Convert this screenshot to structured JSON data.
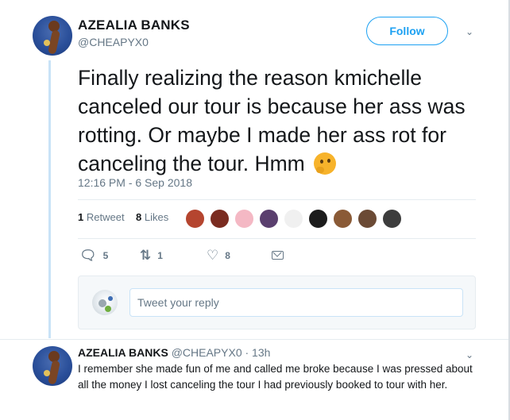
{
  "tweet": {
    "author": {
      "name": "AZEALIA BANKS",
      "handle": "@CHEAPYX0"
    },
    "follow_label": "Follow",
    "text": "Finally realizing the reason kmichelle canceled our tour is because her ass was rotting. Or maybe I made her ass rot for canceling the tour. Hmm",
    "timestamp": "12:16 PM - 6 Sep 2018",
    "stats": {
      "retweets_count": "1",
      "retweets_label": "Retweet",
      "likes_count": "8",
      "likes_label": "Likes"
    },
    "liker_colors": [
      "#b5452f",
      "#7a2b20",
      "#f4b8c4",
      "#5a3f6e",
      "#f0f0f0",
      "#1c1c1c",
      "#8a5a36",
      "#6b4a35",
      "#3d3d3d"
    ],
    "actions": {
      "reply_count": "5",
      "retweet_count": "1",
      "like_count": "8"
    }
  },
  "reply_box": {
    "placeholder": "Tweet your reply"
  },
  "reply_tweet": {
    "name": "AZEALIA BANKS",
    "meta": "@CHEAPYX0 · 13h",
    "text": "I remember she made fun of me and called me broke because I was pressed about all the money I lost canceling the tour I had previously booked to tour with her."
  },
  "colors": {
    "accent": "#1da1f2",
    "muted": "#657786",
    "thread_line": "#c9e3f7"
  }
}
